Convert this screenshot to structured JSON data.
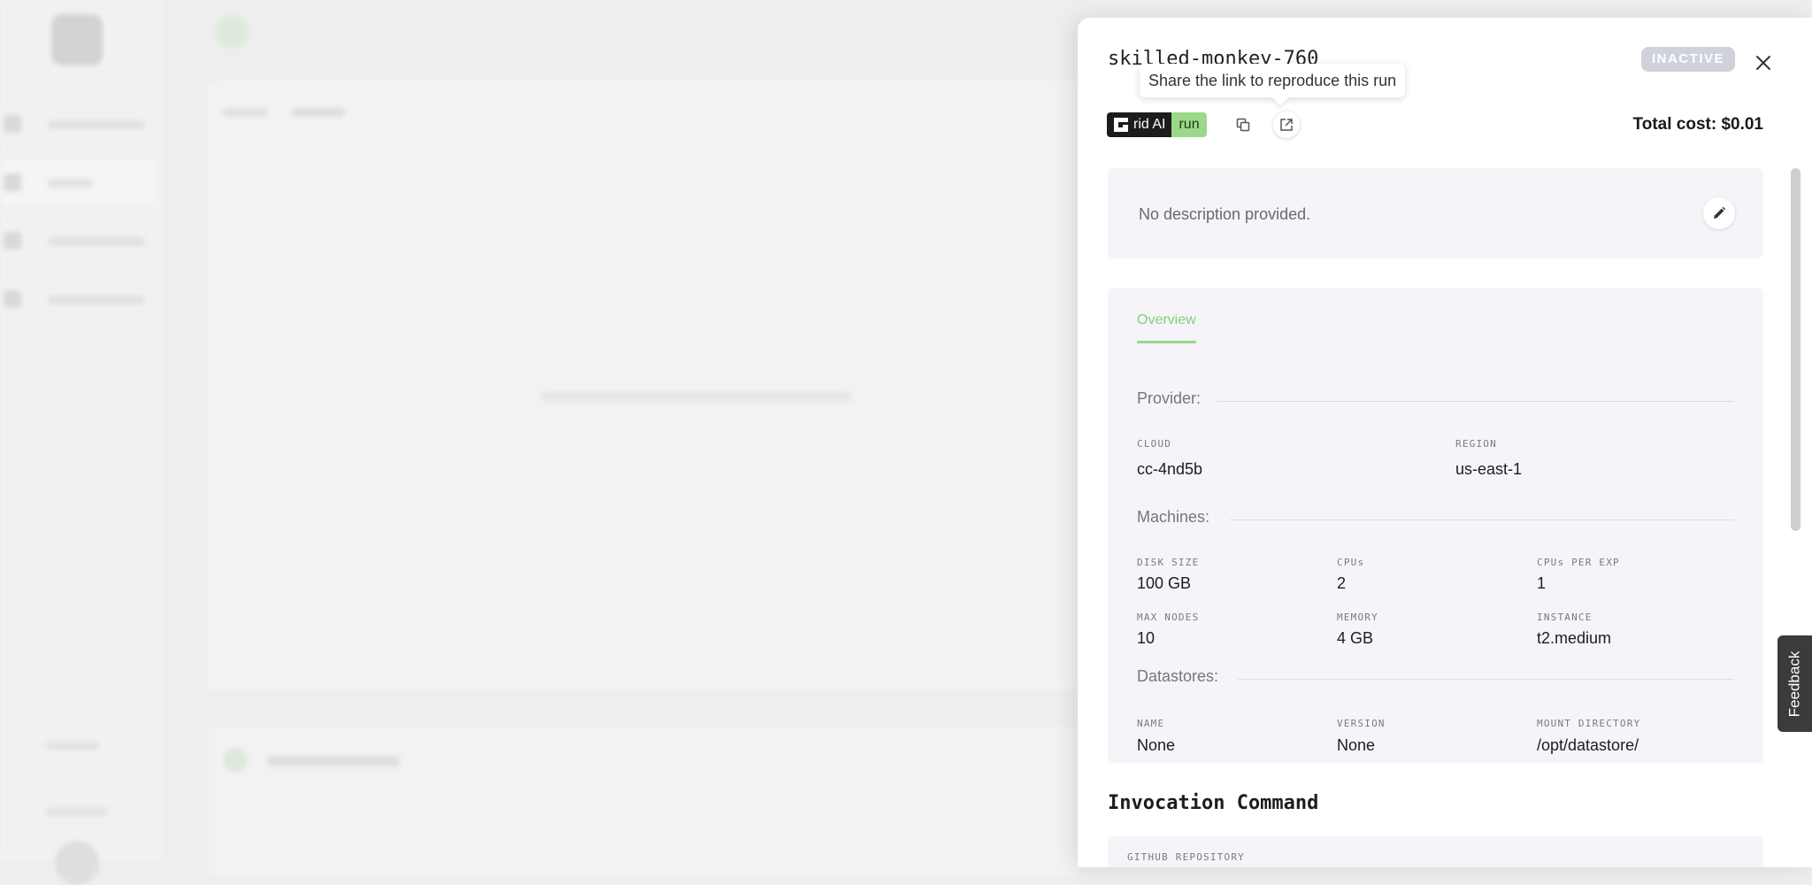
{
  "run": {
    "name": "skilled-monkey-760",
    "status": "INACTIVE",
    "tooltip": "Share the link to reproduce this run",
    "brand_text": "rid AI",
    "brand_suffix": "run",
    "total_cost": "Total cost: $0.01",
    "description": "No description provided."
  },
  "tabs": {
    "overview": "Overview"
  },
  "provider": {
    "title": "Provider:",
    "cloud_label": "CLOUD",
    "cloud_value": "cc-4nd5b",
    "region_label": "REGION",
    "region_value": "us-east-1"
  },
  "machines": {
    "title": "Machines:",
    "disk_label": "DISK SIZE",
    "disk_value": "100 GB",
    "cpus_label": "CPUs",
    "cpus_value": "2",
    "cpus_exp_label": "CPUs PER EXP",
    "cpus_exp_value": "1",
    "nodes_label": "MAX NODES",
    "nodes_value": "10",
    "memory_label": "MEMORY",
    "memory_value": "4 GB",
    "instance_label": "INSTANCE",
    "instance_value": "t2.medium"
  },
  "datastores": {
    "title": "Datastores:",
    "name_label": "NAME",
    "name_value": "None",
    "version_label": "VERSION",
    "version_value": "None",
    "mount_label": "MOUNT DIRECTORY",
    "mount_value": "/opt/datastore/"
  },
  "invocation": {
    "title": "Invocation Command",
    "repo_label": "GITHUB REPOSITORY"
  },
  "feedback": "Feedback",
  "colors": {
    "accent": "#9bd889",
    "badge": "#cfd2dc",
    "panel": "#f5f5f9"
  }
}
